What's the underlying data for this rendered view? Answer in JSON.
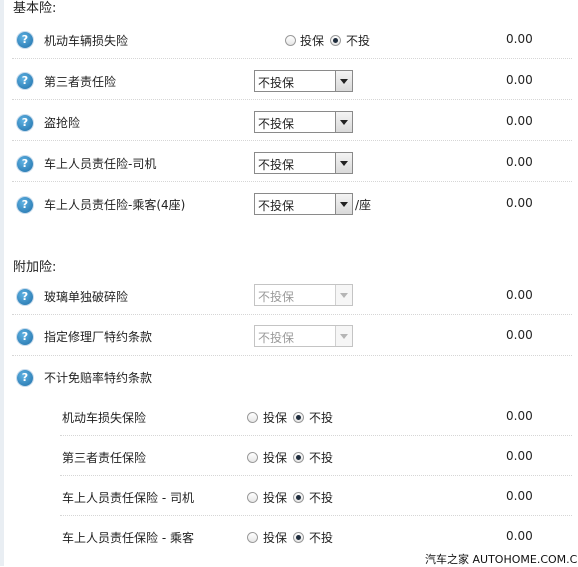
{
  "basic": {
    "title": "基本险:",
    "items": [
      {
        "label": "机动车辆损失险",
        "opt_yes": "投保",
        "opt_no": "不投",
        "amount": "0.00"
      },
      {
        "label": "第三者责任险",
        "select": "不投保",
        "amount": "0.00"
      },
      {
        "label": "盗抢险",
        "select": "不投保",
        "amount": "0.00"
      },
      {
        "label": "车上人员责任险-司机",
        "select": "不投保",
        "amount": "0.00"
      },
      {
        "label": "车上人员责任险-乘客(4座)",
        "select": "不投保",
        "suffix": "/座",
        "amount": "0.00"
      }
    ]
  },
  "addon": {
    "title": "附加险:",
    "items": [
      {
        "label": "玻璃单独破碎险",
        "select": "不投保",
        "amount": "0.00"
      },
      {
        "label": "指定修理厂特约条款",
        "select": "不投保",
        "amount": "0.00"
      },
      {
        "label": "不计免赔率特约条款"
      }
    ],
    "sub_items": [
      {
        "label": "机动车损失保险",
        "opt_yes": "投保",
        "opt_no": "不投",
        "amount": "0.00"
      },
      {
        "label": "第三者责任保险",
        "opt_yes": "投保",
        "opt_no": "不投",
        "amount": "0.00"
      },
      {
        "label": "车上人员责任保险 - 司机",
        "opt_yes": "投保",
        "opt_no": "不投",
        "amount": "0.00"
      },
      {
        "label": "车上人员责任保险 - 乘客",
        "opt_yes": "投保",
        "opt_no": "不投",
        "amount": "0.00"
      }
    ]
  },
  "help_glyph": "?",
  "watermark": "汽车之家 AUTOHOME.COM.CN"
}
